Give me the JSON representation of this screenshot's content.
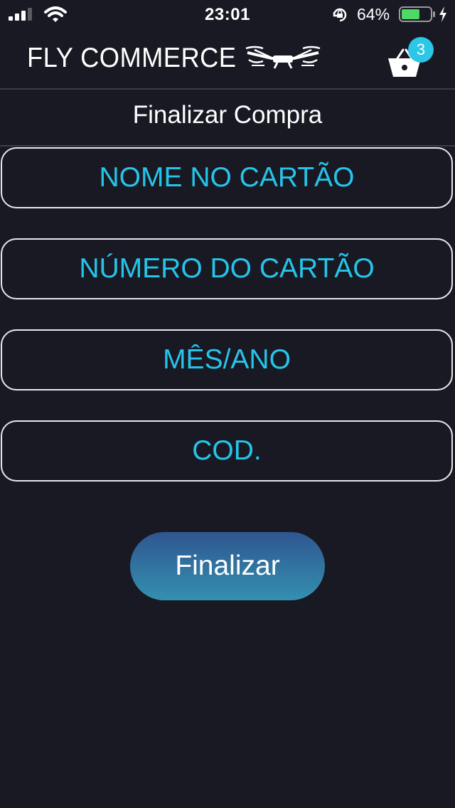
{
  "status_bar": {
    "time": "23:01",
    "battery_percent": "64%",
    "battery_level": 0.64,
    "icons": [
      "signal-icon",
      "wifi-icon",
      "rotation-lock-icon",
      "battery-icon",
      "charging-icon"
    ]
  },
  "header": {
    "brand": "FLY COMMERCE",
    "logo_icon": "drone-icon",
    "cart_icon": "basket-icon",
    "cart_count": "3"
  },
  "page": {
    "title": "Finalizar Compra"
  },
  "form": {
    "fields": [
      {
        "placeholder": "NOME NO CARTÃO",
        "value": ""
      },
      {
        "placeholder": "NÚMERO DO CARTÃO",
        "value": ""
      },
      {
        "placeholder": "MÊS/ANO",
        "value": ""
      },
      {
        "placeholder": "COD.",
        "value": ""
      }
    ],
    "submit_label": "Finalizar"
  },
  "colors": {
    "background": "#181922",
    "accent": "#26c4ea",
    "badge": "#2cc6e6",
    "button_top": "#2f5690",
    "button_bottom": "#3390b0"
  }
}
